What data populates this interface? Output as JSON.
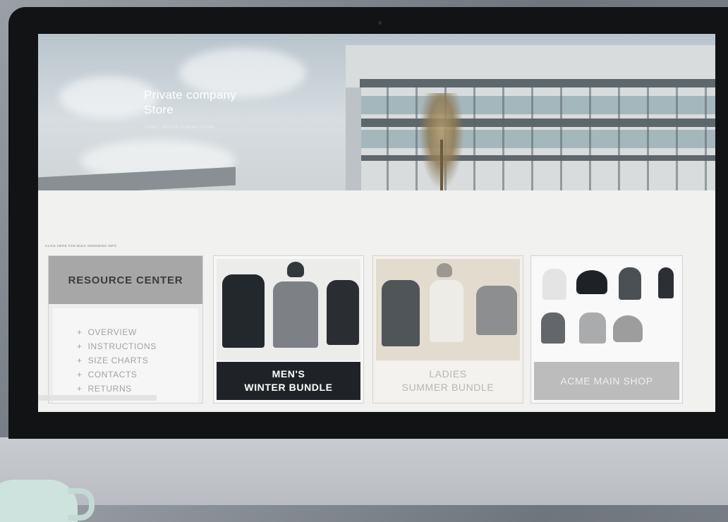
{
  "hero": {
    "title_line1": "Private company",
    "title_line2": "Store",
    "breadcrumb": "HOME  ·  PRIVATE COMPANY STORE"
  },
  "section": {
    "label": "CLICK HERE FOR BULK ORDERING INFO"
  },
  "resource_center": {
    "heading": "RESOURCE CENTER",
    "items": [
      {
        "label": "OVERVIEW"
      },
      {
        "label": "INSTRUCTIONS"
      },
      {
        "label": "SIZE CHARTS"
      },
      {
        "label": "CONTACTS"
      },
      {
        "label": "RETURNS"
      }
    ]
  },
  "cards": {
    "men": {
      "line1": "MEN'S",
      "line2": "WINTER BUNDLE"
    },
    "ladies": {
      "line1": "LADIES",
      "line2": "SUMMER BUNDLE"
    },
    "main": {
      "line1": "ACME MAIN SHOP"
    }
  },
  "colors": {
    "men_caption_bg": "#1f2327",
    "resource_head_bg": "#a7a7a7",
    "main_caption_bg": "#bcbcbc"
  },
  "icons": [
    "camera-dot",
    "plus-bullet"
  ]
}
